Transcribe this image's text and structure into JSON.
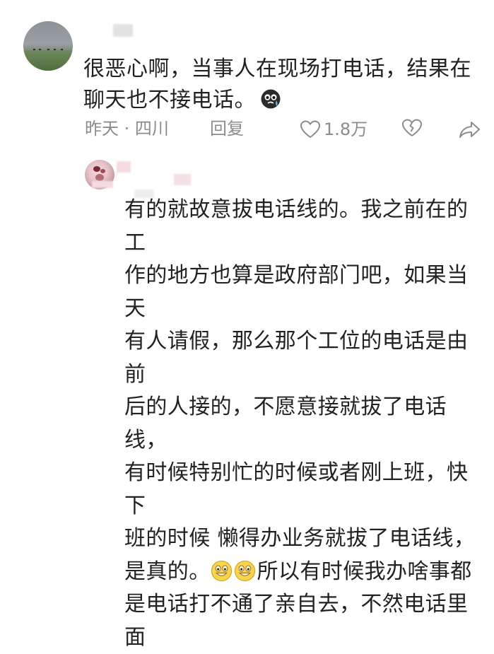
{
  "comment1": {
    "text": "很恶心啊，当事人在现场打电话，结果在聊天也不接电话。",
    "emoji": "crying-face-emoji",
    "meta": "昨天 · 四川",
    "reply_label": "回复",
    "like_count": "1.8万"
  },
  "comment2": {
    "lines_before_emoji": "有的就故意拔电话线的。我之前在的工\n作的地方也算是政府部门吧，如果当天\n有人请假，那么那个工位的电话是由前\n后的人接的，不愿意接就拔了电话线，\n有时候特别忙的时候或者刚上班，快下\n班的时候 懒得办业务就拔了电话线，\n是真的。",
    "after_emoji": "所以有时候我办啥事都",
    "lines_after": "是电话打不通了亲自去，不然电话里面",
    "emoji": "grinning-face-emoji"
  },
  "colors": {
    "text": "#222222",
    "meta": "#8c8c8c",
    "background": "#ffffff"
  }
}
